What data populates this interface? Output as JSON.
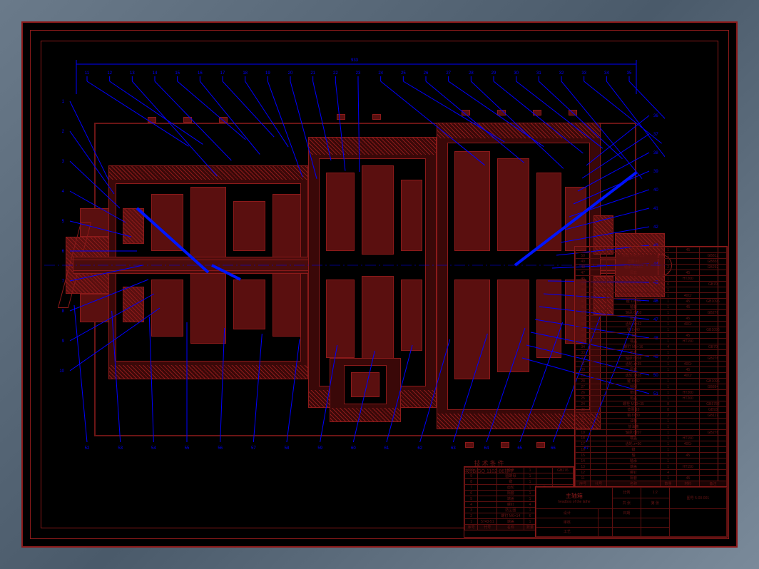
{
  "drawing": {
    "title": "主轴箱",
    "subtitle": "headbox of the lathe",
    "sheet": "图号 5-00-001",
    "scale": "1:2",
    "top_dim": "933",
    "requirements_title": "技术条件",
    "requirements_text": "按JB/GQ 1102-86加工"
  },
  "title_block": {
    "rows": [
      [
        "设计",
        "",
        "日期",
        "",
        "比例"
      ],
      [
        "审核",
        "",
        "",
        "",
        "1:2"
      ],
      [
        "工艺",
        "",
        "",
        "主轴箱",
        ""
      ],
      [
        "标准",
        "",
        "",
        "图号 5-00-001",
        ""
      ]
    ]
  },
  "bom_left": {
    "headers": [
      "序号",
      "代号",
      "名称",
      "数量",
      "材料",
      "备注"
    ],
    "rows": [
      [
        "1",
        "5743-51",
        "端盖",
        "1",
        "HT150",
        ""
      ],
      [
        "2",
        "",
        "螺钉 M6×14",
        "6",
        "",
        "GB70-85"
      ],
      [
        "3",
        "",
        "防尘圈",
        "1",
        "",
        ""
      ],
      [
        "4",
        "",
        "螺钉",
        "4",
        "",
        ""
      ],
      [
        "5",
        "",
        "端盖",
        "1",
        "HT150",
        ""
      ],
      [
        "6",
        "",
        "隔套",
        "1",
        "45",
        ""
      ],
      [
        "7",
        "",
        "齿轮",
        "1",
        "45",
        ""
      ],
      [
        "8",
        "",
        "键",
        "1",
        "",
        ""
      ],
      [
        "9",
        "",
        "圆螺母",
        "1",
        "",
        ""
      ],
      [
        "10",
        "",
        "轴承",
        "1",
        "",
        "GB276"
      ]
    ]
  },
  "bom_right": {
    "headers": [
      "序号",
      "代号",
      "名称",
      "数量",
      "材料",
      "备注"
    ],
    "rows": [
      [
        "51",
        "",
        "主轴",
        "1",
        "45",
        ""
      ],
      [
        "50",
        "",
        "螺母 M45×1.5",
        "1",
        "",
        "GB812"
      ],
      [
        "49",
        "",
        "垫圈 45",
        "1",
        "",
        "GB858"
      ],
      [
        "48",
        "",
        "轴承 7212C",
        "2",
        "",
        "GB292"
      ],
      [
        "47",
        "",
        "隔套",
        "1",
        "45",
        ""
      ],
      [
        "46",
        "",
        "端盖",
        "1",
        "HT200",
        ""
      ],
      [
        "45",
        "",
        "螺钉 M8×20",
        "6",
        "",
        "GB70"
      ],
      [
        "44",
        "",
        "油封",
        "1",
        "",
        ""
      ],
      [
        "43",
        "",
        "齿轮 z=60 m=2",
        "1",
        "40Cr",
        ""
      ],
      [
        "42",
        "",
        "键 10×56",
        "1",
        "45",
        "GB1096"
      ],
      [
        "41",
        "",
        "轴套",
        "1",
        "45",
        ""
      ],
      [
        "40",
        "",
        "轴承 6210",
        "1",
        "",
        "GB276"
      ],
      [
        "39",
        "",
        "隔环",
        "1",
        "45",
        ""
      ],
      [
        "38",
        "",
        "齿轮 z=42",
        "1",
        "40Cr",
        ""
      ],
      [
        "37",
        "",
        "键 8×40",
        "1",
        "",
        "GB1096"
      ],
      [
        "36",
        "",
        "轴",
        "1",
        "45",
        ""
      ],
      [
        "35",
        "",
        "端盖",
        "1",
        "HT150",
        ""
      ],
      [
        "34",
        "",
        "螺钉 M6×16",
        "4",
        "",
        "GB70"
      ],
      [
        "33",
        "",
        "垫片",
        "1",
        "",
        ""
      ],
      [
        "32",
        "",
        "轴承 6208",
        "2",
        "",
        "GB276"
      ],
      [
        "31",
        "",
        "齿轮 z=35",
        "1",
        "40Cr",
        ""
      ],
      [
        "30",
        "",
        "隔套",
        "1",
        "45",
        ""
      ],
      [
        "29",
        "",
        "齿轮 z=28",
        "1",
        "40Cr",
        ""
      ],
      [
        "28",
        "",
        "键 8×32",
        "1",
        "",
        "GB1096"
      ],
      [
        "27",
        "",
        "挡圈",
        "1",
        "",
        "GB894"
      ],
      [
        "26",
        "",
        "箱体",
        "1",
        "HT200",
        ""
      ],
      [
        "25",
        "",
        "箱盖",
        "1",
        "HT200",
        ""
      ],
      [
        "24",
        "",
        "螺栓 M10×35",
        "8",
        "",
        "GB5782"
      ],
      [
        "23",
        "",
        "垫圈 10",
        "8",
        "",
        "GB93"
      ],
      [
        "22",
        "",
        "销 8×30",
        "2",
        "",
        "GB117"
      ],
      [
        "21",
        "",
        "油标",
        "1",
        "",
        ""
      ],
      [
        "20",
        "",
        "放油塞",
        "1",
        "",
        ""
      ],
      [
        "19",
        "",
        "轴承 6207",
        "1",
        "",
        "GB276"
      ],
      [
        "18",
        "",
        "端盖",
        "1",
        "HT150",
        ""
      ],
      [
        "17",
        "",
        "齿轮 z=50",
        "1",
        "40Cr",
        ""
      ],
      [
        "16",
        "",
        "键",
        "1",
        "",
        ""
      ],
      [
        "15",
        "",
        "轴",
        "1",
        "45",
        ""
      ],
      [
        "14",
        "",
        "轴承",
        "1",
        "",
        ""
      ],
      [
        "13",
        "",
        "端盖",
        "1",
        "HT150",
        ""
      ],
      [
        "12",
        "",
        "螺钉",
        "4",
        "",
        ""
      ],
      [
        "11",
        "",
        "隔套",
        "1",
        "45",
        ""
      ]
    ]
  },
  "balloons_top": [
    "11",
    "12",
    "13",
    "14",
    "15",
    "16",
    "17",
    "18",
    "19",
    "20",
    "21",
    "22",
    "23",
    "24",
    "25",
    "26",
    "27",
    "28",
    "29",
    "30",
    "31",
    "32",
    "33",
    "34",
    "35"
  ],
  "balloons_left": [
    "1",
    "2",
    "3",
    "4",
    "5",
    "6",
    "7",
    "8",
    "9",
    "10"
  ],
  "balloons_right": [
    "36",
    "37",
    "38",
    "39",
    "40",
    "41",
    "42",
    "43",
    "44",
    "45",
    "46",
    "47",
    "48",
    "49",
    "50",
    "51"
  ],
  "balloons_bottom": [
    "52",
    "53",
    "54",
    "55",
    "56",
    "57",
    "58",
    "59",
    "60",
    "61",
    "62",
    "63",
    "64",
    "65",
    "66",
    "67"
  ]
}
